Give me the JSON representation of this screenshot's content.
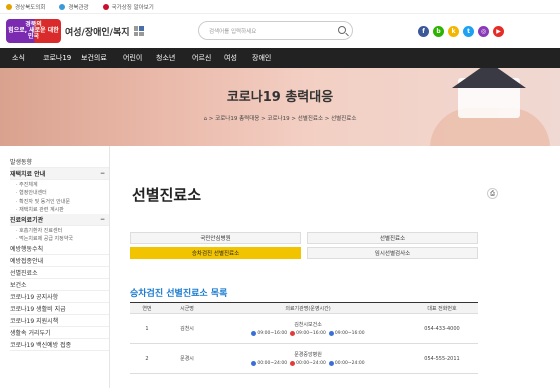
{
  "topbar": {
    "items": [
      {
        "label": "경상북도의회",
        "color": "#e2a200"
      },
      {
        "label": "경북관광",
        "color": "#3a9ad9"
      },
      {
        "label": "국가상징 알아보기",
        "color": "#c8102e"
      }
    ]
  },
  "header": {
    "logo_badge_line1": "경북의",
    "logo_badge_line2": "힘으로, 새로운",
    "logo_badge_line3": "대한민국",
    "site_name": "여성/장애인/복지",
    "search_placeholder": "검색어를 입력하세요",
    "socials": [
      {
        "icon": "facebook-icon",
        "glyph": "f",
        "color": "#3b5998"
      },
      {
        "icon": "blog-icon",
        "glyph": "b",
        "color": "#2db400"
      },
      {
        "icon": "kakao-icon",
        "glyph": "k",
        "color": "#f2b600"
      },
      {
        "icon": "twitter-icon",
        "glyph": "t",
        "color": "#1da1f2"
      },
      {
        "icon": "instagram-icon",
        "glyph": "◎",
        "color": "#8a3ab9"
      },
      {
        "icon": "youtube-icon",
        "glyph": "▶",
        "color": "#e52d27"
      }
    ]
  },
  "gnb": [
    "소식",
    "코로나19",
    "보건의료",
    "어린이",
    "청소년",
    "어르신",
    "여성",
    "장애인"
  ],
  "hero": {
    "title": "코로나19 총력대응",
    "breadcrumb": "⌂ > 코로나19 총력대응 > 코로나19 > 선별진료소 > 선별진료소"
  },
  "sidebar": {
    "items": [
      {
        "label": "발생동향",
        "type": "item"
      },
      {
        "label": "재택치료 안내",
        "type": "head",
        "toggle": "−"
      },
      {
        "label": "· 주진체계",
        "type": "sub"
      },
      {
        "label": "· 협정안내센터",
        "type": "sub"
      },
      {
        "label": "· 확진자 및 동거인 안내문",
        "type": "sub"
      },
      {
        "label": "· 재택치료 관련 계시판",
        "type": "sub"
      },
      {
        "label": "진료의료기관",
        "type": "head",
        "toggle": "−"
      },
      {
        "label": "· 호흡기환자 진료센터",
        "type": "sub"
      },
      {
        "label": "· 먹는치료제 공급 지정약국",
        "type": "sub"
      },
      {
        "label": "예방행동수칙",
        "type": "item"
      },
      {
        "label": "예방접종안내",
        "type": "item"
      },
      {
        "label": "선별진료소",
        "type": "item"
      },
      {
        "label": "보건소",
        "type": "item"
      },
      {
        "label": "코로나19 공지사항",
        "type": "item"
      },
      {
        "label": "코로나19 생활비 지급",
        "type": "item"
      },
      {
        "label": "코로나19 지원시책",
        "type": "item"
      },
      {
        "label": "생활속 거리두기",
        "type": "item"
      },
      {
        "label": "코로나19 백신예방 접종",
        "type": "item"
      }
    ]
  },
  "main": {
    "title": "선별진료소",
    "tabs": [
      {
        "label": "국민안심병원",
        "active": false
      },
      {
        "label": "선별진료소",
        "active": false
      },
      {
        "label": "승차검진 선별진료소",
        "active": true
      },
      {
        "label": "임시선별검사소",
        "active": false
      }
    ],
    "section_title": "승차검진 선별진료소 목록",
    "table": {
      "headers": [
        "연번",
        "시군명",
        "의료기관명(운영시간)",
        "대표 전화번호"
      ],
      "rows": [
        {
          "no": "1",
          "city": "김천시",
          "facility": "김천시보건소",
          "phone": "054-433-4000",
          "sched": [
            {
              "time": "09:00~16:00",
              "color": "#3a6fd8"
            },
            {
              "time": "09:00~16:00",
              "color": "#e23b3b"
            },
            {
              "time": "09:00~16:00",
              "color": "#3a6fd8"
            }
          ]
        },
        {
          "no": "2",
          "city": "문경시",
          "facility": "문경중앙병원",
          "phone": "054-555-2011",
          "sched": [
            {
              "time": "00:00~24:00",
              "color": "#3a6fd8"
            },
            {
              "time": "00:00~24:00",
              "color": "#e23b3b"
            },
            {
              "time": "00:00~24:00",
              "color": "#3a6fd8"
            }
          ]
        }
      ]
    }
  }
}
